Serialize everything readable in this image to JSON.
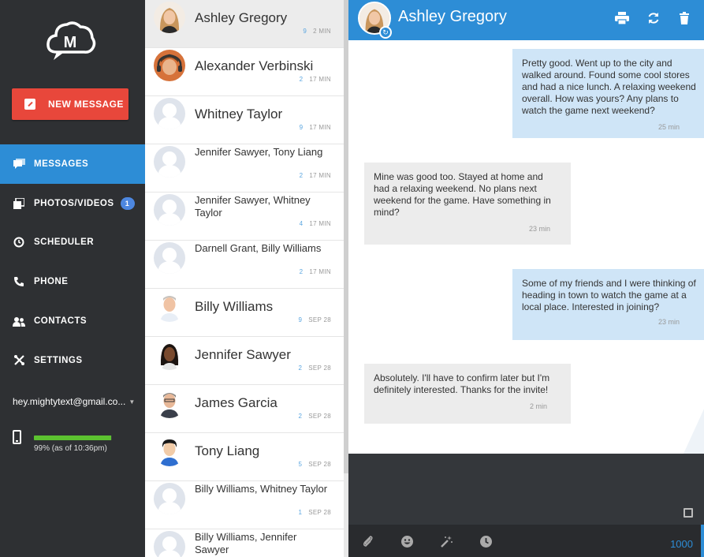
{
  "sidebar": {
    "new_message_label": "NEW MESSAGE",
    "nav": [
      {
        "label": "MESSAGES",
        "icon": "messages-icon",
        "active": true
      },
      {
        "label": "PHOTOS/VIDEOS",
        "icon": "photos-icon",
        "badge": "1"
      },
      {
        "label": "SCHEDULER",
        "icon": "scheduler-icon"
      },
      {
        "label": "PHONE",
        "icon": "phone-icon"
      },
      {
        "label": "CONTACTS",
        "icon": "contacts-icon"
      },
      {
        "label": "SETTINGS",
        "icon": "settings-icon"
      }
    ],
    "account": "hey.mightytext@gmail.co...",
    "battery_text": "99% (as of 10:36pm)",
    "battery_level": 0.99
  },
  "conversations": [
    {
      "name": "Ashley Gregory",
      "count": "9",
      "time": "2 MIN",
      "selected": true
    },
    {
      "name": "Alexander Verbinski",
      "count": "2",
      "time": "17 MIN"
    },
    {
      "name": "Whitney Taylor",
      "count": "9",
      "time": "17 MIN"
    },
    {
      "name": "Jennifer Sawyer, Tony Liang",
      "count": "2",
      "time": "17 MIN"
    },
    {
      "name": "Jennifer Sawyer, Whitney Taylor",
      "count": "4",
      "time": "17 MIN"
    },
    {
      "name": "Darnell Grant, Billy Williams",
      "count": "2",
      "time": "17 MIN"
    },
    {
      "name": "Billy Williams",
      "count": "9",
      "time": "SEP 28"
    },
    {
      "name": "Jennifer Sawyer",
      "count": "2",
      "time": "SEP 28"
    },
    {
      "name": "James Garcia",
      "count": "2",
      "time": "SEP 28"
    },
    {
      "name": "Tony Liang",
      "count": "5",
      "time": "SEP 28"
    },
    {
      "name": "Billy Williams, Whitney Taylor",
      "count": "1",
      "time": "SEP 28"
    },
    {
      "name": "Billy Williams, Jennifer Sawyer",
      "count": "",
      "time": ""
    }
  ],
  "chat": {
    "title": "Ashley Gregory",
    "messages": [
      {
        "dir": "out",
        "text": "Pretty good. Went up to the city and walked around. Found some cool stores and had a nice lunch. A relaxing weekend overall. How was yours? Any plans to watch the game next weekend?",
        "time": "25 min"
      },
      {
        "dir": "in",
        "text": "Mine was good too. Stayed at home and had a relaxing weekend. No plans next weekend for the game. Have something in mind?",
        "time": "23 min"
      },
      {
        "dir": "out",
        "text": "Some of my friends and I were thinking of heading in town to watch the game at a local place. Interested in joining?",
        "time": "23 min"
      },
      {
        "dir": "in",
        "text": "Absolutely. I'll have to confirm later but I'm definitely interested. Thanks for the invite!",
        "time": "2 min"
      }
    ],
    "char_count": "1000"
  },
  "colors": {
    "accent": "#2d8dd6",
    "danger": "#e8473b",
    "sidebar": "#2e3033"
  }
}
